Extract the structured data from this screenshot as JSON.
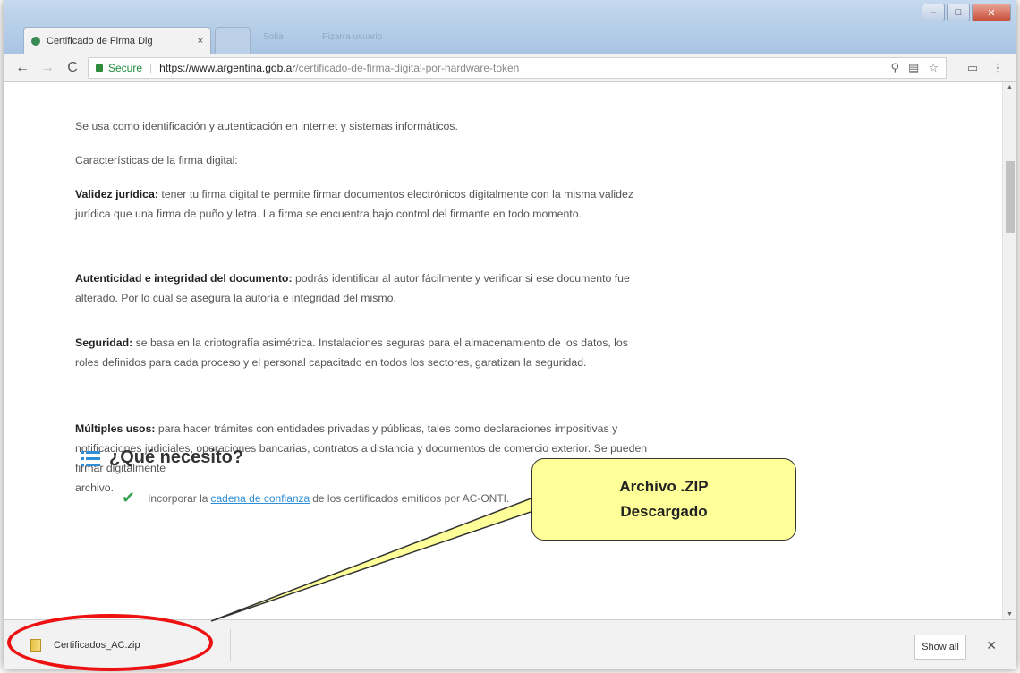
{
  "tab": {
    "title": "Certificado de Firma Dig",
    "close": "×"
  },
  "titlebar": {
    "blur1": "Sofia",
    "blur2": "Pizarra usuario"
  },
  "window_controls": {
    "minimize": "–",
    "maximize": "□",
    "close": "✕"
  },
  "toolbar": {
    "back": "←",
    "forward": "→",
    "reload": "C"
  },
  "address": {
    "secure_label": "Secure",
    "separator": "|",
    "host": "https://www.argentina.gob.ar",
    "path": "/certificado-de-firma-digital-por-hardware-token"
  },
  "page": {
    "p1": "Se usa como identificación y autenticación en internet y sistemas informáticos.",
    "p2": "Características de la firma digital:",
    "p3_bold": "Validez jurídica:",
    "p3_text": " tener tu firma digital te permite firmar documentos electrónicos digitalmente con la misma validez jurídica que una firma de puño y letra. La firma se encuentra bajo control del firmante en todo momento.",
    "p4_bold": "Autenticidad e integridad del documento:",
    "p4_text": " podrás identificar al autor fácilmente y verificar si ese documento fue alterado. Por lo cual se asegura la autoría e integridad del mismo.",
    "p5_bold": "Seguridad:",
    "p5_text": " se basa en la criptografía asimétrica. Instalaciones seguras para el almacenamiento de los datos, los roles definidos para cada proceso y el personal capacitado en todos los sectores, garatizan la seguridad.",
    "p6_bold": "Múltiples usos:",
    "p6_text": " para hacer trámites con entidades privadas y públicas, tales como declaraciones impositivas y notificaciones judiciales, operaciones bancarias, contratos a distancia y documentos de comercio exterior. Se pueden firmar digitalmente",
    "p6_tail": "archivo.",
    "heading": "¿Qué necesito?",
    "check_pre": "Incorporar la",
    "check_link": "cadena de confianza",
    "check_post": "de los certificados emitidos por AC-ONTI."
  },
  "download": {
    "filename": "Certificados_AC.zip",
    "show_all": "Show all",
    "close": "✕"
  },
  "callout": {
    "line1": "Archivo .ZIP",
    "line2": "Descargado"
  },
  "colors": {
    "accent": "#2e8fd8",
    "callout_fill": "#ffff99",
    "highlight": "#ee1111",
    "secure": "#1b8a3a"
  }
}
